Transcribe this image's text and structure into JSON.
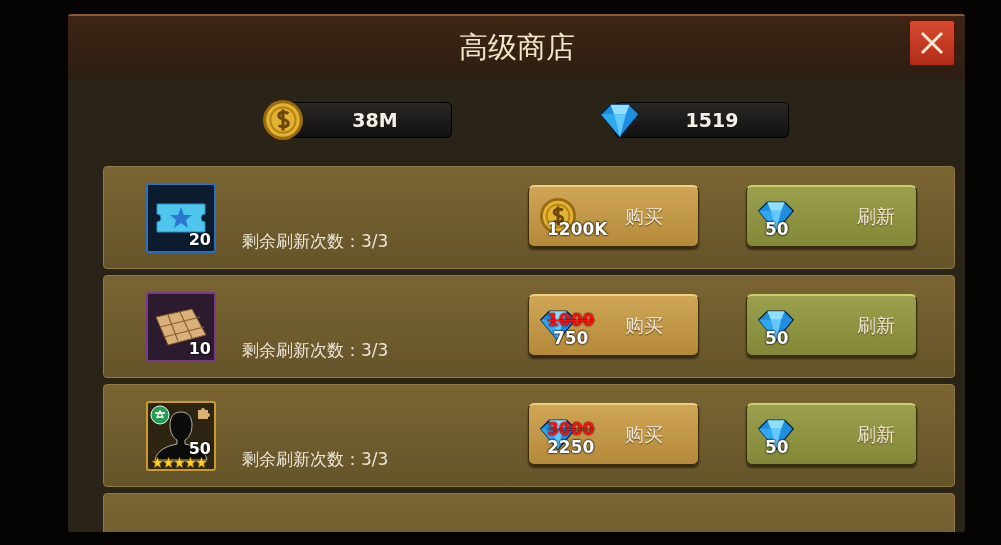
{
  "window": {
    "title": "高级商店"
  },
  "currencies": [
    {
      "kind": "coin",
      "amount": "38M"
    },
    {
      "kind": "gem",
      "amount": "1519"
    }
  ],
  "items": [
    {
      "kind": "ticket",
      "count": "20",
      "remaining": "剩余刷新次数：3/3",
      "buy": {
        "kind": "coin",
        "price": "1200K",
        "label": "购买"
      },
      "refresh": {
        "cost": "50",
        "label": "刷新"
      }
    },
    {
      "kind": "map",
      "count": "10",
      "remaining": "剩余刷新次数：3/3",
      "buy": {
        "kind": "gem",
        "old_price": "1000",
        "price": "750",
        "label": "购买"
      },
      "refresh": {
        "cost": "50",
        "label": "刷新"
      }
    },
    {
      "kind": "hero",
      "count": "50",
      "stars": 5,
      "remaining": "剩余刷新次数：3/3",
      "buy": {
        "kind": "gem",
        "old_price": "3000",
        "price": "2250",
        "label": "购买"
      },
      "refresh": {
        "cost": "50",
        "label": "刷新"
      }
    }
  ]
}
